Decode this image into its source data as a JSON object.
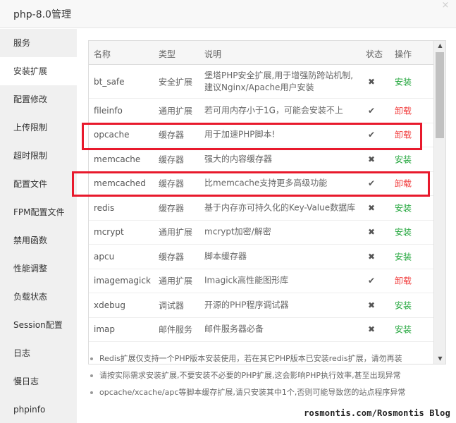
{
  "window": {
    "title": "php-8.0管理",
    "close_icon": "×"
  },
  "sidebar": {
    "items": [
      {
        "label": "服务"
      },
      {
        "label": "安装扩展"
      },
      {
        "label": "配置修改"
      },
      {
        "label": "上传限制"
      },
      {
        "label": "超时限制"
      },
      {
        "label": "配置文件"
      },
      {
        "label": "FPM配置文件"
      },
      {
        "label": "禁用函数"
      },
      {
        "label": "性能调整"
      },
      {
        "label": "负载状态"
      },
      {
        "label": "Session配置"
      },
      {
        "label": "日志"
      },
      {
        "label": "慢日志"
      },
      {
        "label": "phpinfo"
      }
    ],
    "active": "安装扩展"
  },
  "table": {
    "headers": {
      "name": "名称",
      "type": "类型",
      "desc": "说明",
      "state": "状态",
      "op": "操作"
    },
    "rows": [
      {
        "name": "bt_safe",
        "type": "安全扩展",
        "desc1": "堡塔PHP安全扩展,用于增强防跨站机制,",
        "desc2": "建议Nginx/Apache用户安装",
        "state": "✖",
        "op": "安装"
      },
      {
        "name": "fileinfo",
        "type": "通用扩展",
        "desc1": "若可用内存小于1G，可能会安装不上",
        "state": "✔",
        "op": "卸载"
      },
      {
        "name": "opcache",
        "type": "缓存器",
        "desc1": "用于加速PHP脚本!",
        "state": "✔",
        "op": "卸载"
      },
      {
        "name": "memcache",
        "type": "缓存器",
        "desc1": "强大的内容缓存器",
        "state": "✖",
        "op": "安装"
      },
      {
        "name": "memcached",
        "type": "缓存器",
        "desc1": "比memcache支持更多高级功能",
        "state": "✔",
        "op": "卸载"
      },
      {
        "name": "redis",
        "type": "缓存器",
        "desc1": "基于内存亦可持久化的Key-Value数据库",
        "state": "✖",
        "op": "安装"
      },
      {
        "name": "mcrypt",
        "type": "通用扩展",
        "desc1": "mcrypt加密/解密",
        "state": "✖",
        "op": "安装"
      },
      {
        "name": "apcu",
        "type": "缓存器",
        "desc1": "脚本缓存器",
        "state": "✖",
        "op": "安装"
      },
      {
        "name": "imagemagick",
        "type": "通用扩展",
        "desc1": "Imagick高性能图形库",
        "state": "✔",
        "op": "卸载"
      },
      {
        "name": "xdebug",
        "type": "调试器",
        "desc1": "开源的PHP程序调试器",
        "state": "✖",
        "op": "安装"
      },
      {
        "name": "imap",
        "type": "邮件服务",
        "desc1": "邮件服务器必备",
        "state": "✖",
        "op": "安装"
      }
    ]
  },
  "scrollbar": {
    "up_icon": "▲",
    "down_icon": "▼"
  },
  "notes": [
    "Redis扩展仅支持一个PHP版本安装使用，若在其它PHP版本已安装redis扩展，请勿再装",
    "请按实际需求安装扩展,不要安装不必要的PHP扩展,这会影响PHP执行效率,甚至出现异常",
    "opcache/xcache/apc等脚本缓存扩展,请只安装其中1个,否则可能导致您的站点程序异常"
  ],
  "watermark": "rosmontis.com/Rosmontis Blog",
  "colors": {
    "install": "#20a53a",
    "uninstall": "#f13b3b",
    "highlight": "#e8192c"
  }
}
